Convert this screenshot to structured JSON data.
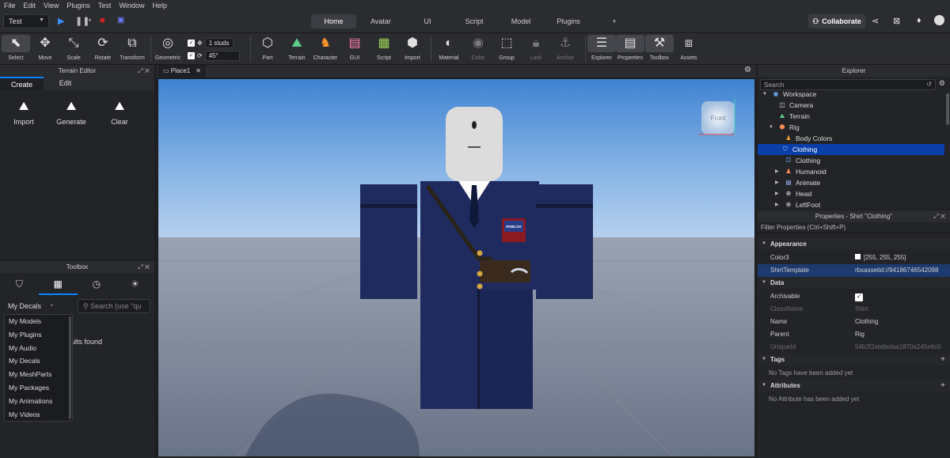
{
  "menu": [
    "File",
    "Edit",
    "View",
    "Plugins",
    "Test",
    "Window",
    "Help"
  ],
  "mode_select": "Test",
  "tabs": [
    "Home",
    "Avatar",
    "UI",
    "Script",
    "Model",
    "Plugins",
    "+"
  ],
  "active_tab": "Home",
  "collaborate_label": "Collaborate",
  "tools": {
    "select": "Select",
    "move": "Move",
    "scale": "Scale",
    "rotate": "Rotate",
    "transform": "Transform",
    "geometric": "Geometric",
    "studs": "1 studs",
    "degrees": "45°",
    "part": "Part",
    "terrain": "Terrain",
    "character": "Character",
    "gui": "GUI",
    "script": "Script",
    "import": "Import",
    "material": "Material",
    "color": "Color",
    "group": "Group",
    "lock": "Lock",
    "anchor": "Anchor",
    "explorer": "Explorer",
    "properties": "Properties",
    "toolbox": "Toolbox",
    "assets": "Assets"
  },
  "terrain_editor": {
    "title": "Terrain Editor",
    "tabs": [
      "Create",
      "Edit"
    ],
    "buttons": {
      "import": "Import",
      "generate": "Generate",
      "clear": "Clear"
    }
  },
  "toolbox": {
    "title": "Toolbox",
    "category": "My Decals",
    "search_placeholder": "Search (use \"qu",
    "results_text": "ults found",
    "options": [
      "My Models",
      "My Plugins",
      "My Audio",
      "My Decals",
      "My MeshParts",
      "My Packages",
      "My Animations",
      "My Videos"
    ]
  },
  "viewport": {
    "tab": "Place1",
    "view_label": "Front",
    "shirt_logo": "ROBLOX"
  },
  "explorer": {
    "title": "Explorer",
    "search_placeholder": "Search",
    "nodes": {
      "workspace": "Workspace",
      "camera": "Camera",
      "terrain": "Terrain",
      "rig": "Rig",
      "body_colors": "Body Colors",
      "clothing_1": "Clothing",
      "clothing_2": "Clothing",
      "humanoid": "Humanoid",
      "animate": "Animate",
      "head": "Head",
      "leftfoot": "LeftFoot"
    }
  },
  "properties": {
    "title": "Properties - Shirt \"Clothing\"",
    "filter": "Filter Properties (Ctrl+Shift+P)",
    "appearance": "Appearance",
    "color3_label": "Color3",
    "color3_value": "[255, 255, 255]",
    "shirttemplate_label": "ShirtTemplate",
    "shirttemplate_value": "rbxassetid://94186746542098",
    "data": "Data",
    "archivable_label": "Archivable",
    "classname_label": "ClassName",
    "classname_value": "Shirt",
    "name_label": "Name",
    "name_value": "Clothing",
    "parent_label": "Parent",
    "parent_value": "Rig",
    "uniqueid_label": "UniqueId",
    "uniqueid_value": "54b2f2ebdedaa1870a245e6c0",
    "tags": "Tags",
    "tags_empty": "No Tags have been added yet",
    "attributes": "Attributes",
    "attributes_empty": "No Attribute has been added yet"
  },
  "colors": {
    "accent": "#0a84ff",
    "selection": "#0a3ea8",
    "uniform": "#1f2a5e"
  }
}
